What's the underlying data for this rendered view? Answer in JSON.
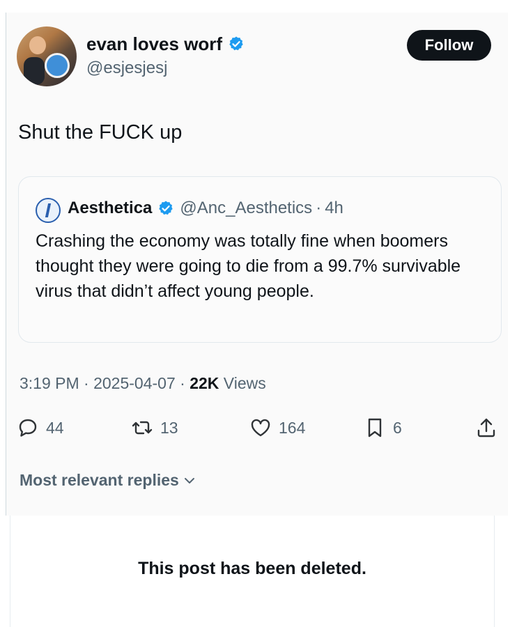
{
  "post": {
    "author": {
      "name": "evan loves worf",
      "handle": "@esjesjesj"
    },
    "follow_label": "Follow",
    "text": "Shut the FUCK up",
    "timestamp": "3:19 PM · 2025-04-07 · ",
    "views_count": "22K",
    "views_label": " Views",
    "stats": {
      "replies": "44",
      "reposts": "13",
      "likes": "164",
      "bookmarks": "6"
    }
  },
  "quote": {
    "name": "Aesthetica",
    "handle": "@Anc_Aesthetics",
    "separator": "·",
    "time": "4h",
    "text": "Crashing the economy was totally fine when boomers thought they were going to die from a 99.7% survivable virus that didn’t affect young people."
  },
  "replies": {
    "sort_label": "Most relevant replies"
  },
  "deleted": {
    "message": "This post has been deleted."
  },
  "icons": {
    "verified": "verified-badge-icon",
    "reply": "speech-bubble-icon",
    "repost": "repost-arrows-icon",
    "like": "heart-icon",
    "bookmark": "bookmark-icon",
    "share": "share-upload-icon",
    "chevron": "chevron-down-icon"
  },
  "colors": {
    "verified_blue": "#1d9bf0",
    "text": "#0f1419",
    "muted": "#536471"
  }
}
